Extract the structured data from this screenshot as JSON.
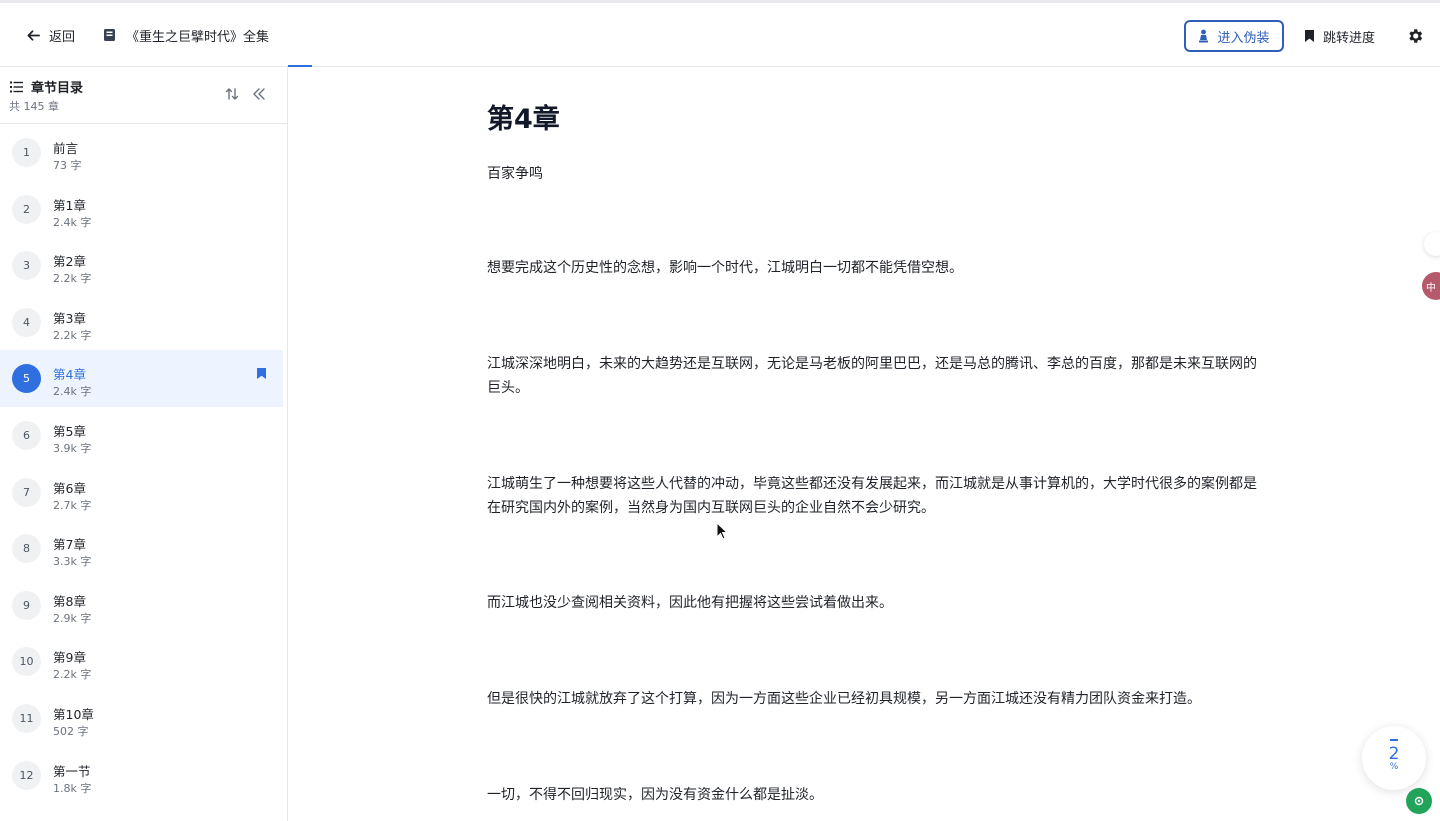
{
  "header": {
    "back_label": "返回",
    "book_title": "《重生之巨擘时代》全集",
    "disguise_label": "进入伪装",
    "jump_label": "跳转进度"
  },
  "sidebar": {
    "title": "章节目录",
    "count": "共 145 章",
    "chapters": [
      {
        "num": "1",
        "name": "前言",
        "words": "73 字"
      },
      {
        "num": "2",
        "name": "第1章",
        "words": "2.4k 字"
      },
      {
        "num": "3",
        "name": "第2章",
        "words": "2.2k 字"
      },
      {
        "num": "4",
        "name": "第3章",
        "words": "2.2k 字"
      },
      {
        "num": "5",
        "name": "第4章",
        "words": "2.4k 字",
        "active": true
      },
      {
        "num": "6",
        "name": "第5章",
        "words": "3.9k 字"
      },
      {
        "num": "7",
        "name": "第6章",
        "words": "2.7k 字"
      },
      {
        "num": "8",
        "name": "第7章",
        "words": "3.3k 字"
      },
      {
        "num": "9",
        "name": "第8章",
        "words": "2.9k 字"
      },
      {
        "num": "10",
        "name": "第9章",
        "words": "2.2k 字"
      },
      {
        "num": "11",
        "name": "第10章",
        "words": "502 字"
      },
      {
        "num": "12",
        "name": "第一节",
        "words": "1.8k 字"
      }
    ]
  },
  "content": {
    "chapter_title": "第4章",
    "paragraphs": [
      "百家争鸣",
      "想要完成这个历史性的念想，影响一个时代，江城明白一切都不能凭借空想。",
      "江城深深地明白，未来的大趋势还是互联网，无论是马老板的阿里巴巴，还是马总的腾讯、李总的百度，那都是未来互联网的巨头。",
      "江城萌生了一种想要将这些人代替的冲动，毕竟这些都还没有发展起来，而江城就是从事计算机的，大学时代很多的案例都是在研究国内外的案例，当然身为国内互联网巨头的企业自然不会少研究。",
      "而江城也没少查阅相关资料，因此他有把握将这些尝试着做出来。",
      "但是很快的江城就放弃了这个打算，因为一方面这些企业已经初具规模，另一方面江城还没有精力团队资金来打造。",
      "一切，不得不回归现实，因为没有资金什么都是扯淡。"
    ]
  },
  "progress": {
    "value": "2",
    "unit": "%"
  },
  "colors": {
    "accent": "#2f6fe0",
    "active_bg": "#eef4ff",
    "locate": "#22a35a"
  }
}
